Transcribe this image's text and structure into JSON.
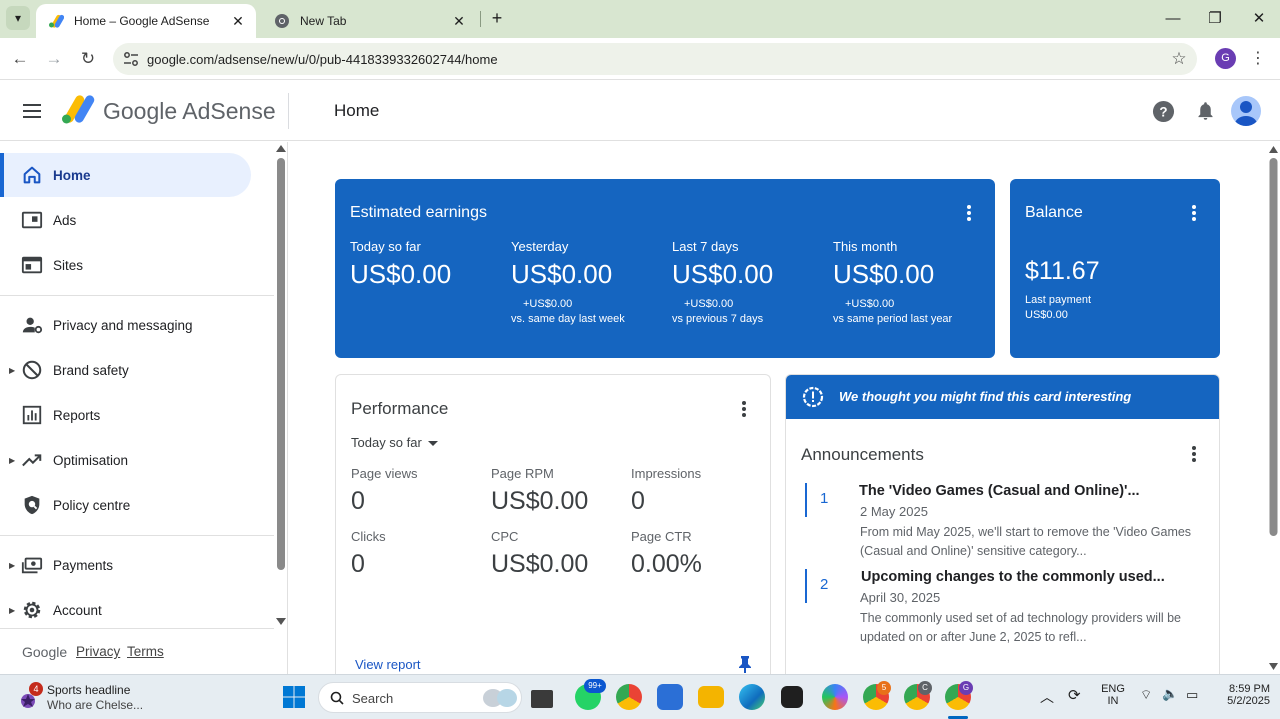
{
  "browser": {
    "tabs": [
      {
        "label": "Home – Google AdSense",
        "active": true
      },
      {
        "label": "New Tab",
        "active": false
      }
    ],
    "url": "google.com/adsense/new/u/0/pub-4418339332602744/home",
    "profile_initial": "G"
  },
  "header": {
    "logo_text": "Google AdSense",
    "page_title": "Home"
  },
  "sidebar": {
    "items": [
      {
        "label": "Home",
        "icon": "home-icon"
      },
      {
        "label": "Ads",
        "icon": "ads-icon"
      },
      {
        "label": "Sites",
        "icon": "sites-icon"
      },
      {
        "label": "Privacy and messaging",
        "icon": "privacy-icon"
      },
      {
        "label": "Brand safety",
        "icon": "block-icon"
      },
      {
        "label": "Reports",
        "icon": "reports-icon"
      },
      {
        "label": "Optimisation",
        "icon": "trending-icon"
      },
      {
        "label": "Policy centre",
        "icon": "shield-icon"
      },
      {
        "label": "Payments",
        "icon": "payments-icon"
      },
      {
        "label": "Account",
        "icon": "gear-icon"
      }
    ],
    "footer": {
      "brand": "Google",
      "privacy": "Privacy",
      "terms": "Terms"
    }
  },
  "earnings": {
    "title": "Estimated earnings",
    "metrics": [
      {
        "label": "Today so far",
        "value": "US$0.00",
        "delta": "",
        "compare": ""
      },
      {
        "label": "Yesterday",
        "value": "US$0.00",
        "delta": "+US$0.00",
        "compare": "vs. same day last week"
      },
      {
        "label": "Last 7 days",
        "value": "US$0.00",
        "delta": "+US$0.00",
        "compare": "vs previous 7 days"
      },
      {
        "label": "This month",
        "value": "US$0.00",
        "delta": "+US$0.00",
        "compare": "vs same period last year"
      }
    ]
  },
  "balance": {
    "title": "Balance",
    "value": "$11.67",
    "last_payment_label": "Last payment",
    "last_payment_value": "US$0.00"
  },
  "performance": {
    "title": "Performance",
    "range": "Today so far",
    "metrics": [
      {
        "label": "Page views",
        "value": "0"
      },
      {
        "label": "Page RPM",
        "value": "US$0.00"
      },
      {
        "label": "Impressions",
        "value": "0"
      },
      {
        "label": "Clicks",
        "value": "0"
      },
      {
        "label": "CPC",
        "value": "US$0.00"
      },
      {
        "label": "Page CTR",
        "value": "0.00%"
      }
    ],
    "view_report": "View report"
  },
  "announcements": {
    "banner": "We thought you might find this card interesting",
    "title": "Announcements",
    "items": [
      {
        "num": "1",
        "title": "The 'Video Games (Casual and Online)'...",
        "date": "2 May 2025",
        "desc": "From mid May 2025, we'll start to remove the 'Video Games (Casual and Online)' sensitive category..."
      },
      {
        "num": "2",
        "title": "Upcoming changes to the commonly used...",
        "date": "April 30, 2025",
        "desc": "The commonly used set of ad technology providers will be updated on or after June 2, 2025 to refl..."
      }
    ]
  },
  "taskbar": {
    "news_badge": "4",
    "news_headline": "Sports headline",
    "news_sub": "Who are Chelse...",
    "search_placeholder": "Search",
    "whatsapp_badge": "99+",
    "chrome_badge_1": "5",
    "chrome_badge_2": "C",
    "chrome_badge_3": "G",
    "lang_1": "ENG",
    "lang_2": "IN",
    "time": "8:59 PM",
    "date": "5/2/2025"
  },
  "colors": {
    "accent_blue": "#1565c0",
    "nav_active_bg": "#e8f0fe"
  }
}
